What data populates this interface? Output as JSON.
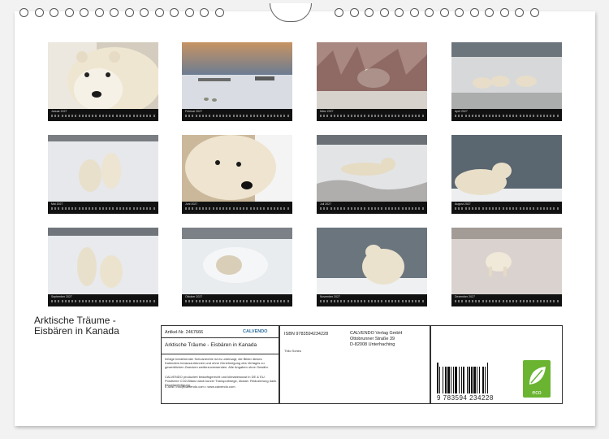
{
  "months": [
    {
      "label": "Januar 2027"
    },
    {
      "label": "Februar 2027"
    },
    {
      "label": "März 2027"
    },
    {
      "label": "April 2027"
    },
    {
      "label": "Mai 2027"
    },
    {
      "label": "Juni 2027"
    },
    {
      "label": "Juli 2027"
    },
    {
      "label": "August 2027"
    },
    {
      "label": "September 2027"
    },
    {
      "label": "Oktober 2027"
    },
    {
      "label": "November 2027"
    },
    {
      "label": "Dezember 2027"
    }
  ],
  "title": {
    "line1": "Arktische Träume -",
    "line2": "Eisbären in Kanada"
  },
  "info": {
    "article_no": "Artikel-Nr. 2467666",
    "publisher_logo": "CALVENDO",
    "product_title": "Arktische Träume - Eisbären in Kanada",
    "isbn": "ISBN 9783594234228",
    "author": "Thilo Scheu",
    "publisher_name": "CALVENDO Verlag GmbH",
    "publisher_street": "Ottobrunner Straße 39",
    "publisher_city": "D-82008 Unterhaching",
    "legal_text": "Infolge bestehender Schutzrechte ist es untersagt, die Bilder dieses Kalenders herauszutrennen und ohne Genehmigung des Verlages zu gewerblichen Zwecken weiterzuverwenden. Alle Angaben ohne Gewähr.",
    "production_text": "CALVENDO produziert bedarfsgerecht und klimabewusst in DE & EU. Positivere CO2-Bilanz dank kurzer Transportwege, ökolab. Reduzierung dank Einzelanfertigung.",
    "contact_text": "E-Mail: info@calvendo.com • www.calvendo.com",
    "barcode_number": "9 783594 234228",
    "eco_label": "eco"
  }
}
